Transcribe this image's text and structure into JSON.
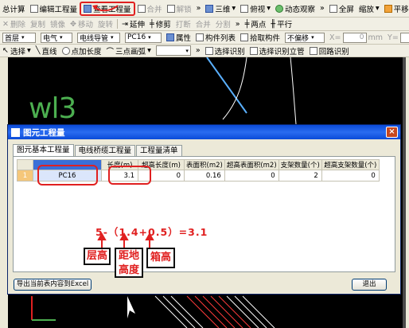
{
  "toolbar1": {
    "calc": "总计算",
    "edit_qty": "编辑工程量",
    "view_qty": "查看工程量",
    "merge": "合并",
    "split": "解锁",
    "view3d": "三维",
    "top_view": "俯视",
    "dynamic": "动态观察",
    "fullscreen": "全屏",
    "zoom": "缩放",
    "pan": "平移"
  },
  "toolbar2": {
    "delete": "删除",
    "copy": "复制",
    "mirror": "镜像",
    "move": "移动",
    "rotate": "旋转",
    "extend": "延伸",
    "trim": "修剪",
    "break": "打断",
    "merge": "合并",
    "split": "分割",
    "two_point": "两点",
    "parallel": "平行"
  },
  "toolbar3": {
    "floor": "首层",
    "discipline": "电气",
    "type": "电线导管",
    "spec": "PC16",
    "property": "属性",
    "component_list": "构件列表",
    "pick": "拾取构件",
    "offset_mode": "不偏移",
    "x_label": "X=",
    "x_value": "0",
    "unit_x": "mm",
    "y_label": "Y=",
    "y_value": "0"
  },
  "toolbar4": {
    "select": "选择",
    "line": "直线",
    "add_length": "点加长度",
    "arc": "三点画弧",
    "select_identify": "选择识别",
    "riser_identify": "选择识别立管",
    "loop_identify": "回路识别"
  },
  "canvas": {
    "label": "wl3"
  },
  "dialog": {
    "title": "图元工程量",
    "close": "×",
    "tabs": [
      "图元基本工程量",
      "电线桥缆工程量",
      "工程量清单"
    ],
    "table": {
      "headers": [
        "",
        "构件名称",
        "长度(m)",
        "超高长度(m)",
        "表面积(m2)",
        "超高表面积(m2)",
        "支架数量(个)",
        "超高支架数量(个)"
      ],
      "rows": [
        [
          "1",
          "PC16",
          "3.1",
          "0",
          "0.16",
          "0",
          "2",
          "0"
        ]
      ]
    },
    "formula": "5-（1.4+0.5）=3.1",
    "labels": {
      "floor_height": "层高",
      "distance_from_floor": "距地高度",
      "box_height": "箱高"
    },
    "export_button": "导出当前表内容到Excel",
    "exit_button": "退出"
  },
  "colors": {
    "title_bar": "#0a4ad8",
    "annotation_red": "#e02020",
    "canvas_bg": "#000000",
    "canvas_text": "#4caf50"
  }
}
